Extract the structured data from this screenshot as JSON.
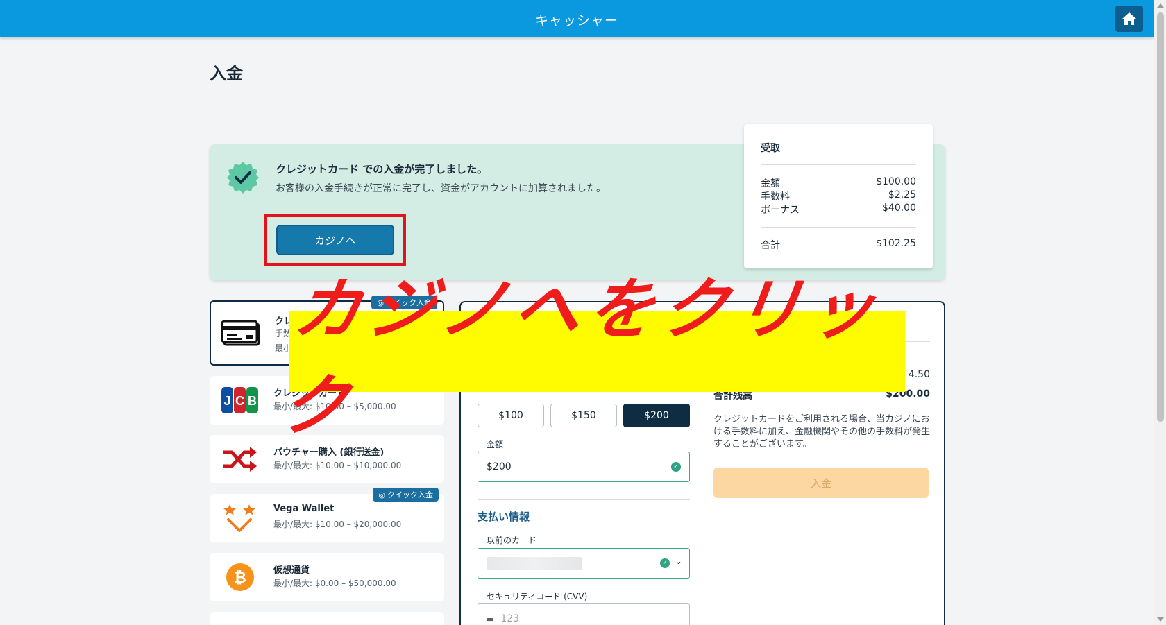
{
  "header": {
    "title": "キャッシャー"
  },
  "page": {
    "title": "入金"
  },
  "success": {
    "title": "クレジットカード での入金が完了しました。",
    "message": "お客様の入金手続きが正常に完了し、資金がアカウントに加算されました。",
    "button_label": "カジノへ"
  },
  "receipt": {
    "title": "受取",
    "rows": [
      {
        "label": "金額",
        "value": "$100.00"
      },
      {
        "label": "手数料",
        "value": "$2.25"
      },
      {
        "label": "ボーナス",
        "value": "$40.00"
      }
    ],
    "total_label": "合計",
    "total_value": "$102.25"
  },
  "methods": [
    {
      "name": "クレ",
      "line2": "手数",
      "line3": "最小",
      "quick": "クイック入金",
      "icon": "credit-card-icon"
    },
    {
      "name": "クレジットカード",
      "range": "最小/最大: $10.00 – $5,000.00",
      "icon": "jcb-icon"
    },
    {
      "name": "バウチャー購入 (銀行送金)",
      "range": "最小/最大: $10.00 – $10,000.00",
      "icon": "shuffle-icon"
    },
    {
      "name": "Vega Wallet",
      "range": "最小/最大: $10.00 – $20,000.00",
      "quick": "クイック入金",
      "icon": "vega-wallet-icon"
    },
    {
      "name": "仮想通貨",
      "range": "最小/最大: $0.00 – $50,000.00",
      "icon": "bitcoin-icon"
    }
  ],
  "form": {
    "amount_options": [
      "$100",
      "$150",
      "$200"
    ],
    "selected_amount": "$200",
    "amount_label": "金額",
    "amount_value": "$200",
    "payment_section_title": "支払い情報",
    "previous_card_label": "以前のカード",
    "cvv_label": "セキュリティコード (CVV)",
    "cvv_placeholder": "123",
    "fee_partial": "4.50",
    "total_balance_label": "合計残高",
    "total_balance_value": "$200.00",
    "note": "クレジットカードをご利用される場合、当カジノにおける手数料に加え、金融機関やその他の手数料が発生することがございます。",
    "deposit_label": "入金"
  },
  "overlay": {
    "text": "カジノへをクリック"
  },
  "colors": {
    "header": "#0a98de",
    "success_bg": "#d3ede4",
    "accent_red": "#e4131b",
    "overlay_yellow": "#fffb01"
  }
}
